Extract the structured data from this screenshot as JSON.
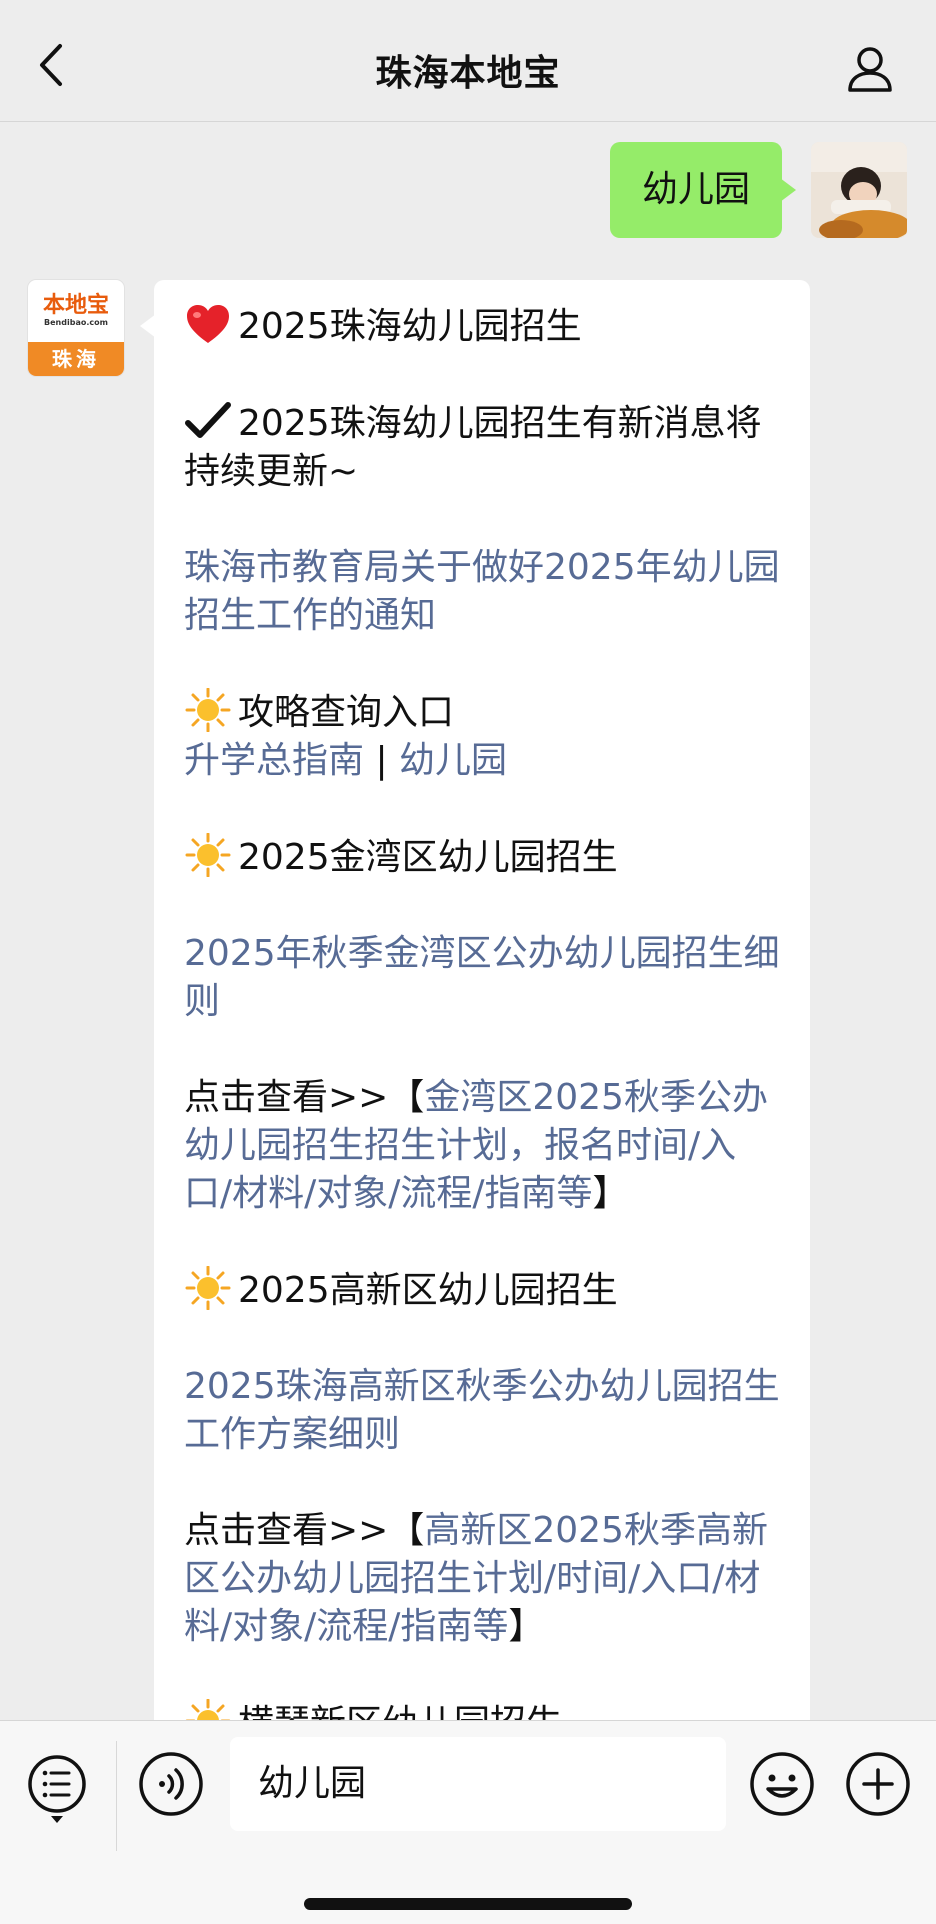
{
  "header": {
    "title": "珠海本地宝"
  },
  "chat": {
    "sent_message": "幼儿园",
    "bot_avatar": {
      "logo_text": "本地宝",
      "logo_sub": "Bendibao.com",
      "city": "珠海"
    },
    "reply": {
      "p1": "2025珠海幼儿园招生",
      "p2": "2025珠海幼儿园招生有新消息将持续更新~",
      "p3_link": "珠海市教育局关于做好2025年幼儿园招生工作的通知",
      "p4_heading": "攻略查询入口",
      "p4_link1": "升学总指南",
      "p4_sep": " | ",
      "p4_link2": "幼儿园",
      "p5_heading": "2025金湾区幼儿园招生",
      "p6_link": "2025年秋季金湾区公办幼儿园招生细则",
      "p7_prefix": "点击查看>>【",
      "p7_link": "金湾区2025秋季公办幼儿园招生招生计划，报名时间/入口/材料/对象/流程/指南等",
      "p7_suffix": "】",
      "p8_heading": "2025高新区幼儿园招生",
      "p9_link": "2025珠海高新区秋季公办幼儿园招生工作方案细则",
      "p10_prefix": "点击查看>>【",
      "p10_link": "高新区2025秋季高新区公办幼儿园招生计划/时间/入口/材料/对象/流程/指南等",
      "p10_suffix": "】",
      "p11_heading": "横琴新区幼儿园招生"
    }
  },
  "input": {
    "value": "幼儿园"
  },
  "icons": {
    "back": "chevron-left-icon",
    "profile": "person-icon",
    "heart": "red-heart-icon",
    "check": "check-mark-icon",
    "sun": "sun-icon",
    "menu": "list-icon",
    "voice": "voice-icon",
    "emoji": "smiley-icon",
    "plus": "plus-icon"
  },
  "colors": {
    "sent_bubble": "#95ec69",
    "link": "#576b95",
    "background": "#ededed"
  }
}
